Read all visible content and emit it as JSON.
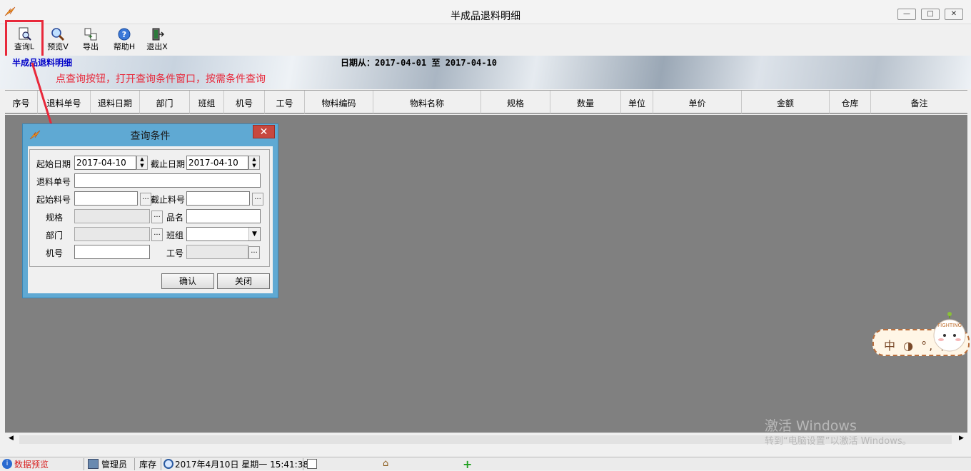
{
  "window": {
    "title": "半成品退料明细",
    "controls": {
      "minimize": "—",
      "maximize": "□",
      "close": "✕"
    }
  },
  "toolbar": {
    "items": [
      {
        "label": "查询L",
        "icon": "query-doc-icon"
      },
      {
        "label": "预览V",
        "icon": "magnifier-icon"
      },
      {
        "label": "导出",
        "icon": "export-icon"
      },
      {
        "label": "帮助H",
        "icon": "help-icon"
      },
      {
        "label": "退出X",
        "icon": "exit-icon"
      }
    ]
  },
  "banner": {
    "title": "半成品退料明细",
    "date_range": "日期从：2017-04-01 至 2017-04-10",
    "annotation": "点查询按钮，打开查询条件窗口，按需条件查询"
  },
  "grid": {
    "columns": [
      "序号",
      "退料单号",
      "退料日期",
      "部门",
      "班组",
      "机号",
      "工号",
      "物料编码",
      "物料名称",
      "规格",
      "数量",
      "单位",
      "单价",
      "金额",
      "仓库",
      "备注"
    ]
  },
  "dialog": {
    "title": "查询条件",
    "close": "✕",
    "fields": {
      "start_date": {
        "label": "起始日期",
        "value": "2017-04-10"
      },
      "end_date": {
        "label": "截止日期",
        "value": "2017-04-10"
      },
      "return_no": {
        "label": "退料单号",
        "value": ""
      },
      "start_material": {
        "label": "起始料号",
        "value": ""
      },
      "end_material": {
        "label": "截止料号",
        "value": ""
      },
      "spec": {
        "label": "规格",
        "value": ""
      },
      "product_name": {
        "label": "品名",
        "value": ""
      },
      "department": {
        "label": "部门",
        "value": ""
      },
      "team": {
        "label": "班组",
        "value": ""
      },
      "machine_no": {
        "label": "机号",
        "value": ""
      },
      "worker_no": {
        "label": "工号",
        "value": ""
      }
    },
    "ellipsis": "...",
    "confirm": "确认",
    "cancel": "关闭"
  },
  "watermark": {
    "line1": "激活 Windows",
    "line2": "转到“电脑设置”以激活 Windows。"
  },
  "ime": {
    "text": "中 ◑ °, 简",
    "mascot": "FIGHTING"
  },
  "statusbar": {
    "items": [
      "数据预览",
      "管理员",
      "库存",
      "2017年4月10日 星期一 15:41:38"
    ]
  },
  "colors": {
    "accent_red": "#e8283a",
    "banner_title": "#0000c8",
    "dialog_frame": "#5fa9d3",
    "grid_body": "#808080"
  }
}
